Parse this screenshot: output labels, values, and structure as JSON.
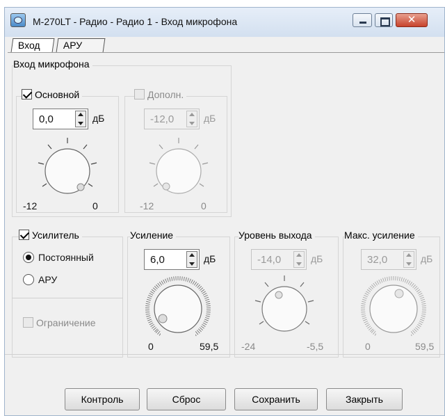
{
  "window": {
    "title": "M-270LT - Радио - Радио 1 - Вход микрофона",
    "close_glyph": "✕"
  },
  "tabs": [
    {
      "label": "Вход",
      "active": true
    },
    {
      "label": "АРУ",
      "active": false
    }
  ],
  "mic_input": {
    "group_label": "Вход микрофона",
    "main": {
      "label": "Основной",
      "checked": true,
      "value": "0,0",
      "unit": "дБ",
      "min_label": "-12",
      "max_label": "0"
    },
    "extra": {
      "label": "Дополн.",
      "checked": false,
      "enabled": false,
      "value": "-12,0",
      "unit": "дБ",
      "min_label": "-12",
      "max_label": "0"
    }
  },
  "amplifier": {
    "checkbox_label": "Усилитель",
    "checked": true,
    "modes": [
      {
        "label": "Постоянный",
        "selected": true
      },
      {
        "label": "АРУ",
        "selected": false
      }
    ],
    "limit_label": "Ограничение",
    "limit_checked": false,
    "limit_enabled": false
  },
  "gain": {
    "label": "Усиление",
    "value": "6,0",
    "unit": "дБ",
    "min_label": "0",
    "max_label": "59,5"
  },
  "output_level": {
    "label": "Уровень выхода",
    "value": "-14,0",
    "unit": "дБ",
    "min_label": "-24",
    "max_label": "-5,5",
    "enabled": false
  },
  "max_gain": {
    "label": "Макс. усиление",
    "value": "32,0",
    "unit": "дБ",
    "min_label": "0",
    "max_label": "59,5",
    "enabled": false
  },
  "buttons": {
    "control": "Контроль",
    "reset": "Сброс",
    "save": "Сохранить",
    "close": "Закрыть"
  },
  "colors": {
    "window_bg": "#f0f0f0",
    "close_button": "#c7432c",
    "disabled_text": "#8a8a8a"
  }
}
